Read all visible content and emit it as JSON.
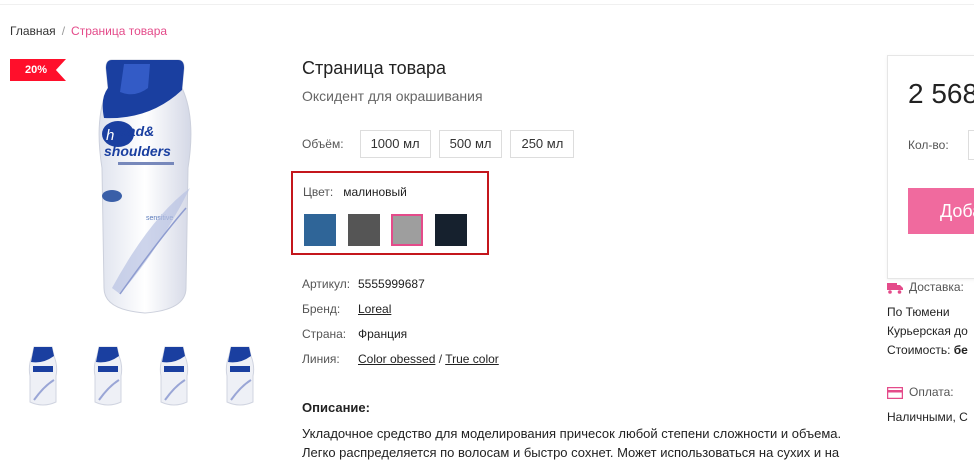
{
  "breadcrumb": {
    "home": "Главная",
    "separator": "/",
    "current": "Страница товара"
  },
  "gallery": {
    "badge": "20%",
    "brand_text": "head&shoulders",
    "thumbnails_count": 4
  },
  "product": {
    "title": "Страница товара",
    "subtitle": "Оксидент для окрашивания",
    "volume": {
      "label": "Объём:",
      "options": [
        "1000 мл",
        "500 мл",
        "250 мл"
      ]
    },
    "color": {
      "label": "Цвет:",
      "value": "малиновый",
      "swatches": [
        "#2f6598",
        "#555555",
        "#9e9e9e",
        "#16212e"
      ],
      "selected_index": 2
    },
    "props": {
      "sku_label": "Артикул:",
      "sku": "5555999687",
      "brand_label": "Бренд:",
      "brand": "Loreal",
      "country_label": "Страна:",
      "country": "Франция",
      "line_label": "Линия:",
      "line_1": "Color obessed",
      "line_sep": "/",
      "line_2": "True color"
    },
    "description_title": "Описание:",
    "description_lines": [
      "Укладочное средство для моделирования причесок любой степени сложности и объема.",
      "Легко распределяется по волосам и быстро сохнет. Может использоваться на сухих и на"
    ]
  },
  "buy": {
    "price": "2 568",
    "qty_label": "Кол-во:",
    "add_button": "Доба",
    "accent": "#f06a9e"
  },
  "delivery": {
    "title": "Доставка:",
    "line1": "По Тюмени",
    "line2": "Курьерская до",
    "cost_label": "Стоимость:",
    "cost_value": "бе"
  },
  "payment": {
    "title": "Оплата:",
    "line1": "Наличными, С"
  }
}
